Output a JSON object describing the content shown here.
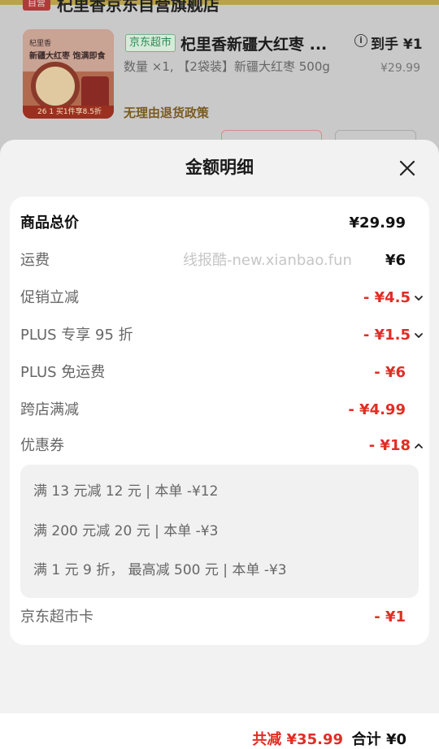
{
  "background_page": {
    "shop_badge": "自营",
    "shop_name": "杞里香京东自营旗舰店",
    "product_image_line1": "杞里香",
    "product_image_line2": "新疆大红枣 饱满即食",
    "product_image_strip": "26 1   买1件享8.5折",
    "channel_tag": "京东超市",
    "product_title": "杞里香新疆大红枣 ...",
    "info_icon": "i",
    "to_hand_label": "到手 ¥1",
    "product_desc": "数量 ×1, 【2袋装】新疆大红枣 500g",
    "product_price": "¥29.99",
    "return_policy": "无理由退货政策"
  },
  "sheet": {
    "title": "金额明细",
    "rows": [
      {
        "label": "商品总价",
        "value": "¥29.99"
      },
      {
        "label": "运费",
        "value": "¥6"
      },
      {
        "label": "促销立减",
        "value": "- ¥4.5"
      },
      {
        "label": "PLUS 专享 95 折",
        "value": "- ¥1.5"
      },
      {
        "label": "PLUS 免运费",
        "value": "- ¥6"
      },
      {
        "label": "跨店满减",
        "value": "- ¥4.99"
      },
      {
        "label": "优惠券",
        "value": "- ¥18"
      },
      {
        "label": "京东超市卡",
        "value": "- ¥1"
      }
    ],
    "watermark": "线报酷-new.xianbao.fun",
    "coupons": [
      "满 13 元减 12 元 | 本单 -¥12",
      "满 200 元减 20 元 | 本单 -¥3",
      "满 1 元 9 折， 最高减 500 元 | 本单 -¥3"
    ]
  },
  "footer": {
    "saved": "共减 ¥35.99",
    "total": "合计 ¥0"
  },
  "colors": {
    "accent_red": "#e02e24",
    "sheet_bg": "#f2f2f2",
    "card_bg": "#ffffff"
  },
  "icons": {
    "close": "close-icon",
    "expand": "chevron-down-icon",
    "collapse": "chevron-up-icon",
    "info": "info-icon"
  }
}
